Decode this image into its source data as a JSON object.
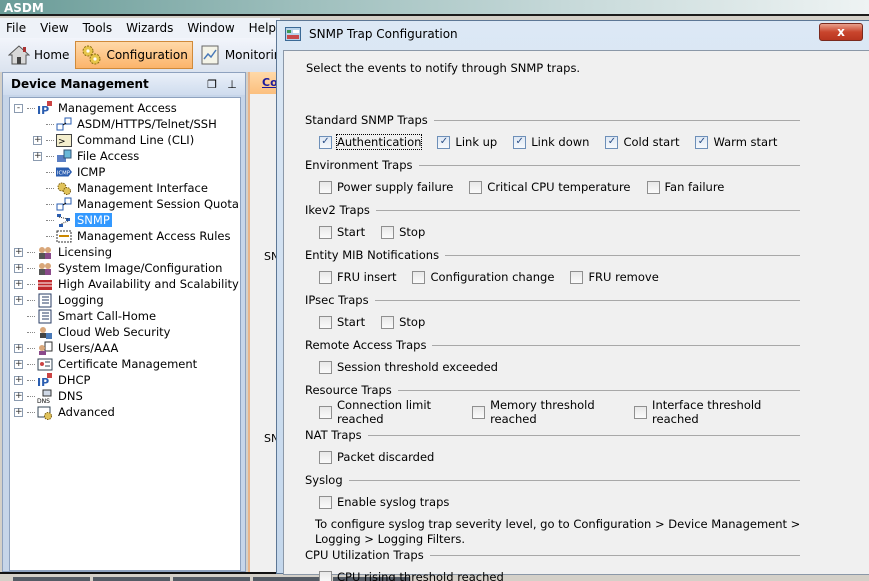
{
  "app": {
    "title": "ASDM"
  },
  "menu": [
    "File",
    "View",
    "Tools",
    "Wizards",
    "Window",
    "Help"
  ],
  "toolbar": {
    "home_label": "Home",
    "configuration_label": "Configuration",
    "monitoring_label": "Monitoring"
  },
  "left_panel": {
    "title": "Device Management",
    "tree": [
      {
        "label": "Management Access",
        "level": 0,
        "expander": "-",
        "icon": "ip-icon"
      },
      {
        "label": "ASDM/HTTPS/Telnet/SSH",
        "level": 1,
        "expander": "",
        "icon": "network-access-icon"
      },
      {
        "label": "Command Line (CLI)",
        "level": 1,
        "expander": "+",
        "icon": "cli-icon"
      },
      {
        "label": "File Access",
        "level": 1,
        "expander": "+",
        "icon": "file-access-icon"
      },
      {
        "label": "ICMP",
        "level": 1,
        "expander": "",
        "icon": "icmp-icon"
      },
      {
        "label": "Management Interface",
        "level": 1,
        "expander": "",
        "icon": "gears-icon"
      },
      {
        "label": "Management Session Quota",
        "level": 1,
        "expander": "",
        "icon": "network-access-icon"
      },
      {
        "label": "SNMP",
        "level": 1,
        "expander": "",
        "icon": "snmp-icon",
        "selected": true
      },
      {
        "label": "Management Access Rules",
        "level": 1,
        "expander": "",
        "icon": "access-rules-icon"
      },
      {
        "label": "Licensing",
        "level": 0,
        "expander": "+",
        "icon": "users-icon"
      },
      {
        "label": "System Image/Configuration",
        "level": 0,
        "expander": "+",
        "icon": "users-icon"
      },
      {
        "label": "High Availability and Scalability",
        "level": 0,
        "expander": "+",
        "icon": "firewall-icon"
      },
      {
        "label": "Logging",
        "level": 0,
        "expander": "+",
        "icon": "log-icon"
      },
      {
        "label": "Smart Call-Home",
        "level": 0,
        "expander": "",
        "icon": "log-icon"
      },
      {
        "label": "Cloud Web Security",
        "level": 0,
        "expander": "",
        "icon": "cloud-security-icon"
      },
      {
        "label": "Users/AAA",
        "level": 0,
        "expander": "+",
        "icon": "users-aaa-icon"
      },
      {
        "label": "Certificate Management",
        "level": 0,
        "expander": "+",
        "icon": "certificate-icon"
      },
      {
        "label": "DHCP",
        "level": 0,
        "expander": "+",
        "icon": "ip-icon"
      },
      {
        "label": "DNS",
        "level": 0,
        "expander": "+",
        "icon": "dns-icon"
      },
      {
        "label": "Advanced",
        "level": 0,
        "expander": "+",
        "icon": "advanced-icon"
      }
    ]
  },
  "content_panel": {
    "tab_label": "Co",
    "sn_label_1": "SN",
    "sn_label_2": "SN"
  },
  "dialog": {
    "title": "SNMP Trap Configuration",
    "close_label": "x",
    "intro": "Select the events to notify through SNMP traps.",
    "groups": [
      {
        "title": "Standard SNMP Traps",
        "items": [
          {
            "label": "Authentication",
            "checked": true,
            "focused": true
          },
          {
            "label": "Link up",
            "checked": true
          },
          {
            "label": "Link down",
            "checked": true
          },
          {
            "label": "Cold start",
            "checked": true
          },
          {
            "label": "Warm start",
            "checked": true
          }
        ]
      },
      {
        "title": "Environment Traps",
        "items": [
          {
            "label": "Power supply failure",
            "checked": false
          },
          {
            "label": "Critical CPU temperature",
            "checked": false
          },
          {
            "label": "Fan failure",
            "checked": false
          }
        ]
      },
      {
        "title": "Ikev2 Traps",
        "items": [
          {
            "label": "Start",
            "checked": false
          },
          {
            "label": "Stop",
            "checked": false
          }
        ]
      },
      {
        "title": "Entity MIB Notifications",
        "items": [
          {
            "label": "FRU insert",
            "checked": false
          },
          {
            "label": "Configuration change",
            "checked": false
          },
          {
            "label": "FRU remove",
            "checked": false
          }
        ]
      },
      {
        "title": "IPsec Traps",
        "items": [
          {
            "label": "Start",
            "checked": false
          },
          {
            "label": "Stop",
            "checked": false
          }
        ]
      },
      {
        "title": "Remote Access Traps",
        "items": [
          {
            "label": "Session threshold exceeded",
            "checked": false
          }
        ]
      },
      {
        "title": "Resource Traps",
        "items": [
          {
            "label": "Connection limit reached",
            "checked": false
          },
          {
            "label": "Memory threshold reached",
            "checked": false
          },
          {
            "label": "Interface threshold reached",
            "checked": false
          }
        ]
      },
      {
        "title": "NAT Traps",
        "items": [
          {
            "label": "Packet discarded",
            "checked": false
          }
        ]
      },
      {
        "title": "Syslog",
        "items": [
          {
            "label": "Enable syslog traps",
            "checked": false
          }
        ],
        "note": "To configure syslog trap severity level, go to Configuration > Device Management > Logging > Logging Filters."
      },
      {
        "title": "CPU Utilization Traps",
        "items": [
          {
            "label": "CPU rising threshold reached",
            "checked": false
          }
        ]
      }
    ]
  }
}
